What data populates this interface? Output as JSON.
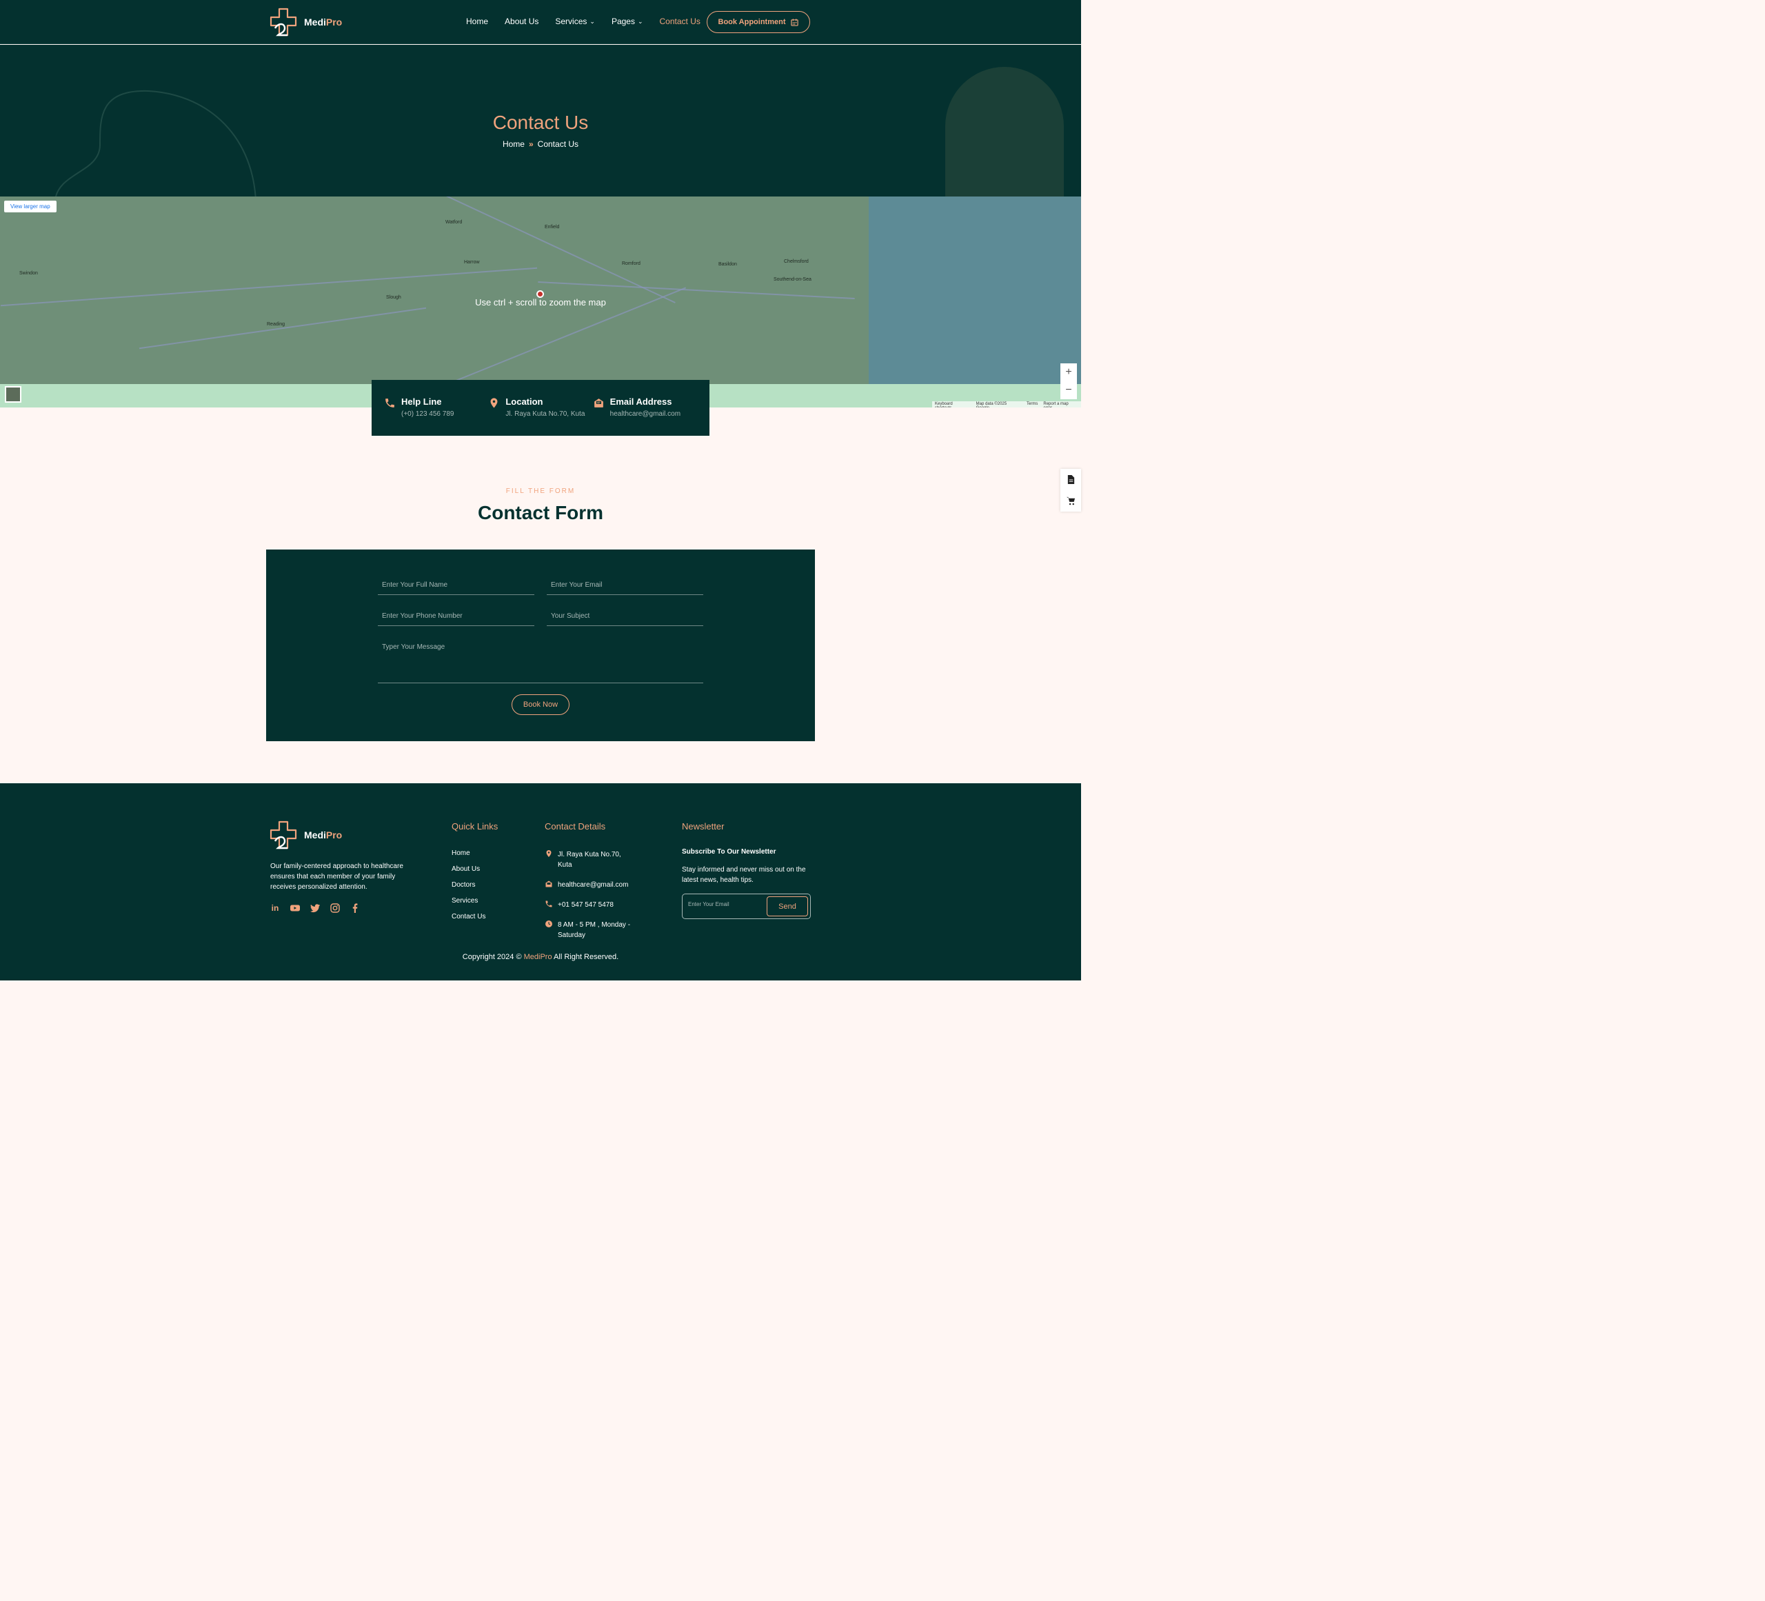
{
  "brand": {
    "name_part1": "Medi",
    "name_part2": "Pro"
  },
  "nav": {
    "items": [
      {
        "label": "Home"
      },
      {
        "label": "About Us"
      },
      {
        "label": "Services",
        "dropdown": true
      },
      {
        "label": "Pages",
        "dropdown": true
      },
      {
        "label": "Contact Us",
        "active": true
      }
    ],
    "book_button": "Book Appointment"
  },
  "hero": {
    "title": "Contact Us",
    "breadcrumb": [
      "Home",
      "Contact Us"
    ]
  },
  "map": {
    "larger_link": "View larger map",
    "hint": "Use ctrl + scroll to zoom the map",
    "zoom_in": "+",
    "zoom_out": "−",
    "credits": [
      "Keyboard shortcuts",
      "Map data ©2025 Google",
      "Terms",
      "Report a map error"
    ],
    "towns": [
      "Watford",
      "Enfield",
      "Harrow",
      "Slough",
      "Reading",
      "Romford",
      "Southend-on-Sea",
      "Swindon",
      "Basildon",
      "Chelmsford"
    ]
  },
  "info": {
    "helpline_title": "Help Line",
    "helpline_value": "(+0) 123 456 789",
    "location_title": "Location",
    "location_value": "Jl. Raya Kuta No.70, Kuta",
    "email_title": "Email Address",
    "email_value": "healthcare@gmail.com"
  },
  "form": {
    "subtitle": "FILL THE FORM",
    "title": "Contact Form",
    "name_placeholder": "Enter Your Full Name",
    "email_placeholder": "Enter Your Email",
    "phone_placeholder": "Enter Your Phone Number",
    "subject_placeholder": "Your Subject",
    "message_placeholder": "Typer Your Message",
    "submit": "Book Now"
  },
  "footer": {
    "description": "Our family-centered approach to healthcare ensures that each member of your family receives personalized attention.",
    "quick_links_title": "Quick Links",
    "quick_links": [
      "Home",
      "About Us",
      "Doctors",
      "Services",
      "Contact Us"
    ],
    "contact_title": "Contact Details",
    "contact_address": "Jl. Raya Kuta No.70, Kuta",
    "contact_email": "healthcare@gmail.com",
    "contact_phone": "+01 547 547 5478",
    "contact_hours": "8 AM - 5 PM , Monday - Saturday",
    "newsletter_title": "Newsletter",
    "newsletter_subtitle": "Subscribe To Our Newsletter",
    "newsletter_desc": "Stay informed and never miss out on the latest news, health tips.",
    "newsletter_placeholder": "Enter Your Email",
    "newsletter_send": "Send",
    "copyright_prefix": "Copyright 2024 © ",
    "copyright_brand": "MediPro",
    "copyright_suffix": " All Right Reserved."
  },
  "colors": {
    "primary": "#04312f",
    "accent": "#f0a37d",
    "background": "#fff6f3"
  }
}
